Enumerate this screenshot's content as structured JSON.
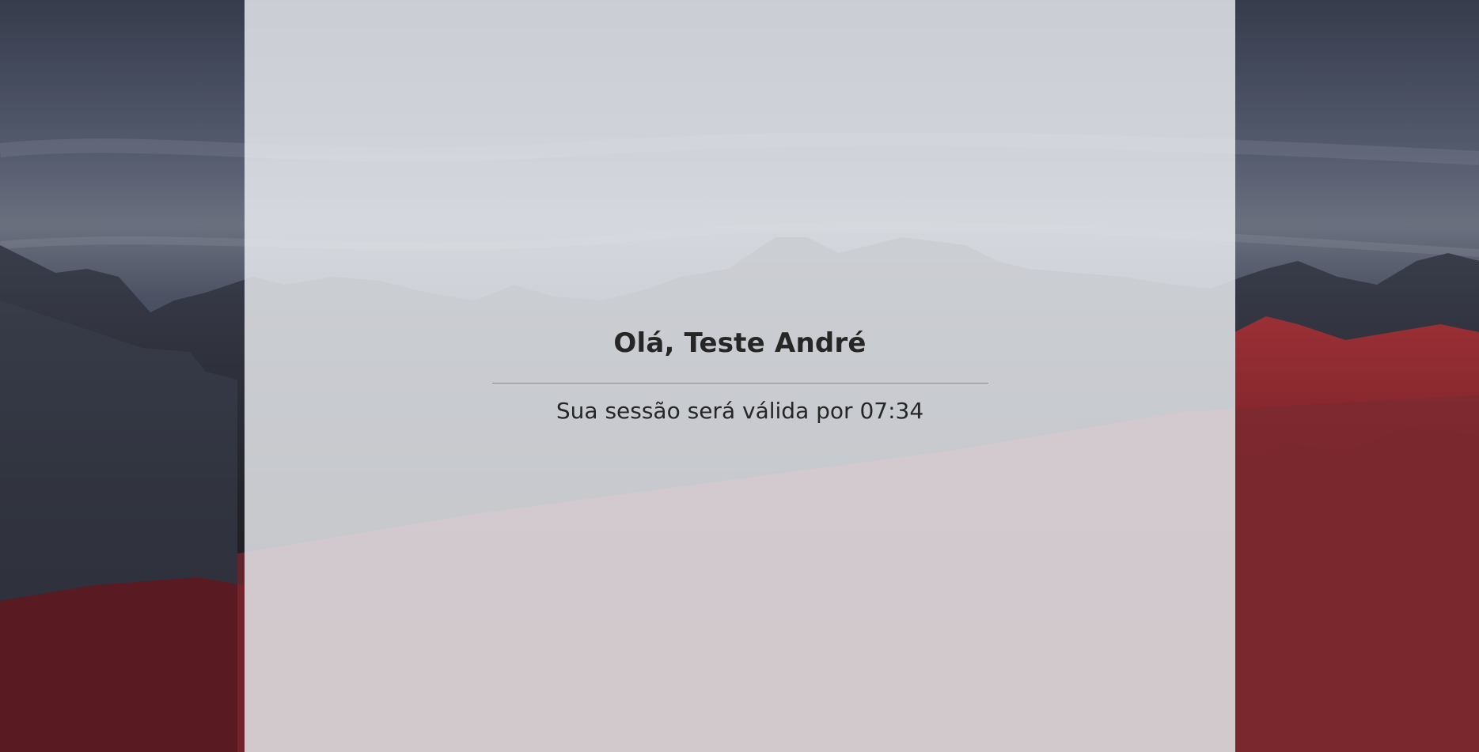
{
  "welcome": {
    "greeting": "Olá, Teste André",
    "session_message": "Sua sessão será válida por 07:34"
  },
  "background": {
    "description_icon": "mountain-landscape",
    "sky_color": "#4a5163",
    "rock_color": "#2b2b33",
    "red_rock_color": "#8e2a2e"
  },
  "panel": {
    "overlay_color": "#eceef2"
  }
}
